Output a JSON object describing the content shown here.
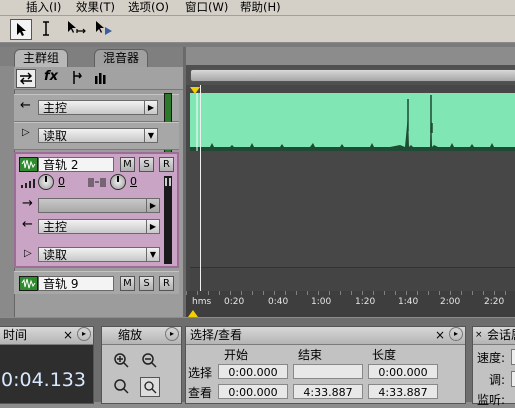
{
  "menu": {
    "items": [
      "插入(I)",
      "效果(T)",
      "选项(O)",
      "窗口(W)",
      "帮助(H)"
    ]
  },
  "toolbar": {
    "tools": [
      "select-tool-icon",
      "time-selection-tool-icon",
      "move-tool-icon",
      "scrub-tool-icon"
    ]
  },
  "tabs": {
    "main_group": "主群组",
    "mixer": "混音器"
  },
  "track_panel": {
    "icons": [
      "swap-icon",
      "fx-icon",
      "route-icon",
      "levels-icon"
    ],
    "master_output": "主控",
    "master_read": "读取",
    "track2": {
      "name": "音轨 2",
      "m": "M",
      "s": "S",
      "r": "R",
      "volume": "0",
      "pan": "0",
      "output": "主控",
      "read": "读取"
    },
    "track9": {
      "name": "音轨 9",
      "m": "M",
      "s": "S",
      "r": "R"
    }
  },
  "timeline": {
    "unit": "hms",
    "ticks": [
      "0:20",
      "0:40",
      "1:00",
      "1:20",
      "1:40",
      "2:00",
      "2:20"
    ]
  },
  "time_panel": {
    "title": "时间",
    "value": "0:04.133"
  },
  "zoom_panel": {
    "title": "缩放"
  },
  "selection_panel": {
    "title": "选择/查看",
    "col_start": "开始",
    "col_end": "结束",
    "col_length": "长度",
    "row_select": "选择",
    "row_view": "查看",
    "select_start": "0:00.000",
    "select_end": "",
    "select_length": "0:00.000",
    "view_start": "0:00.000",
    "view_end": "4:33.887",
    "view_length": "4:33.887"
  },
  "session_panel": {
    "title": "会话属",
    "speed": "速度:",
    "key": "调:",
    "beat": "监听:"
  },
  "colors": {
    "waveform": "#7fe6b4",
    "track_selected": "#cfa3c8"
  }
}
